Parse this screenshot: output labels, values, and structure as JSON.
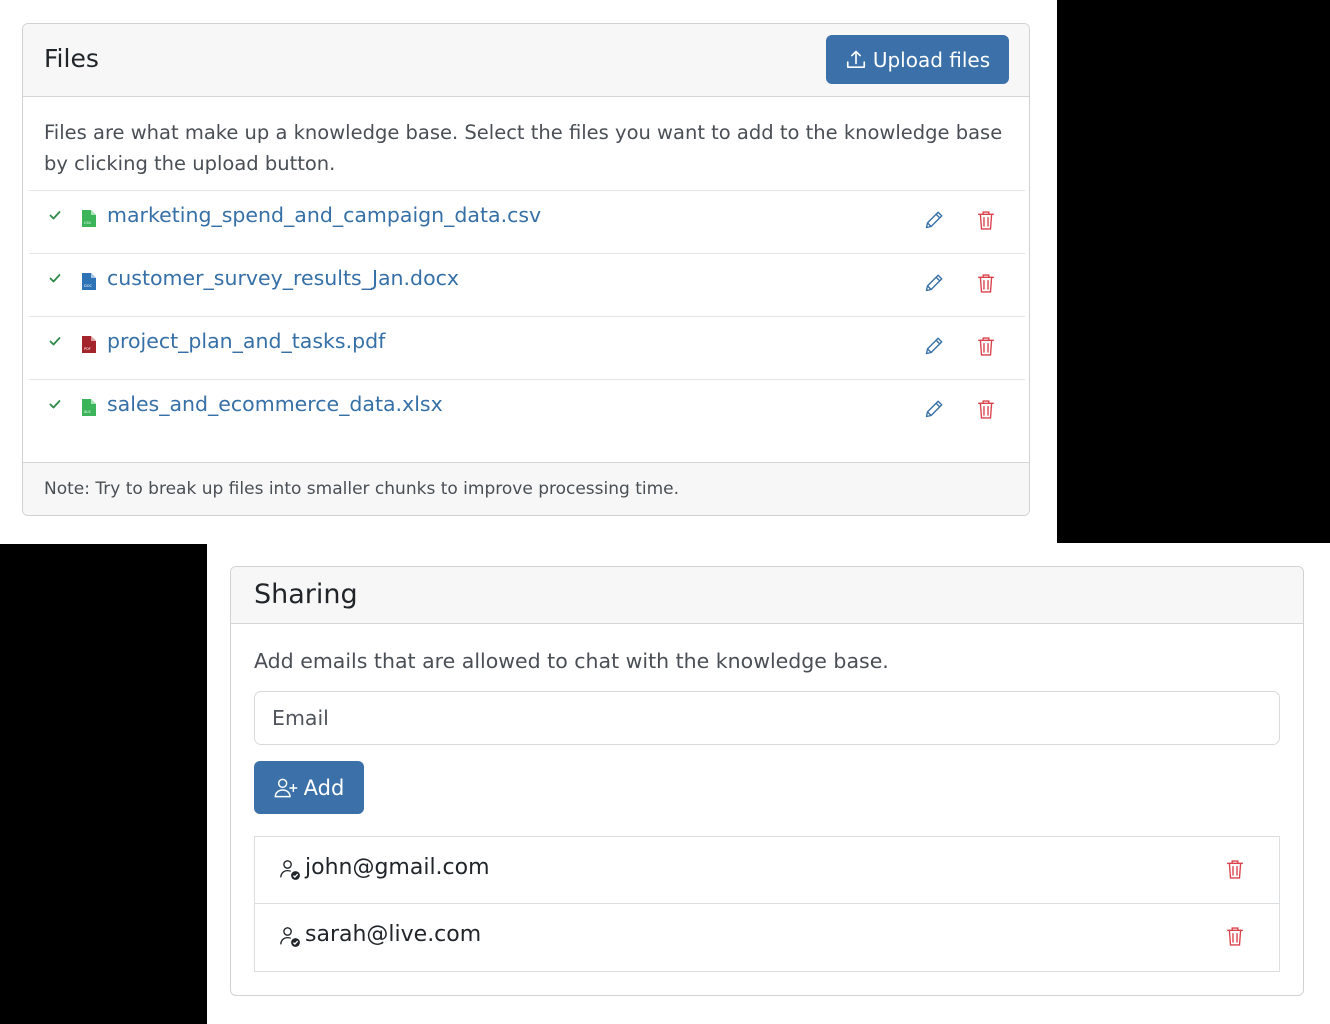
{
  "files_card": {
    "title": "Files",
    "upload_button": "Upload files",
    "description": "Files are what make up a knowledge base. Select the files you want to add to the knowledge base by clicking the upload button.",
    "files": [
      {
        "name": "marketing_spend_and_campaign_data.csv",
        "type": "csv",
        "type_label": "CSV",
        "icon_color": "#3cb55a"
      },
      {
        "name": "customer_survey_results_Jan.docx",
        "type": "docx",
        "type_label": "DOC",
        "icon_color": "#2f73b7"
      },
      {
        "name": "project_plan_and_tasks.pdf",
        "type": "pdf",
        "type_label": "PDF",
        "icon_color": "#a3242a"
      },
      {
        "name": "sales_and_ecommerce_data.xlsx",
        "type": "xlsx",
        "type_label": "XLS",
        "icon_color": "#3cb55a"
      }
    ],
    "note": "Note: Try to break up files into smaller chunks to improve processing time."
  },
  "sharing_card": {
    "title": "Sharing",
    "description": "Add emails that are allowed to chat with the knowledge base.",
    "email_placeholder": "Email",
    "add_button": "Add",
    "emails": [
      "john@gmail.com",
      "sarah@live.com"
    ]
  },
  "icons": {
    "upload": "upload-icon",
    "check": "check-icon",
    "edit": "pencil-icon",
    "delete": "trash-icon",
    "add_user": "person-plus-icon",
    "user_check": "person-check-icon"
  },
  "colors": {
    "primary": "#3b71a8",
    "link": "#3670a6",
    "success": "#2f8a4a",
    "danger": "#d9424b"
  }
}
